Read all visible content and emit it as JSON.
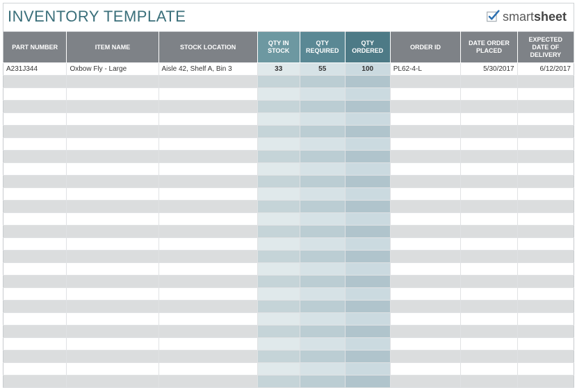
{
  "title": "INVENTORY TEMPLATE",
  "logo": {
    "brand_part1": "smart",
    "brand_part2": "sheet"
  },
  "columns": [
    "PART NUMBER",
    "ITEM NAME",
    "STOCK LOCATION",
    "QTY IN STOCK",
    "QTY REQUIRED",
    "QTY ORDERED",
    "ORDER ID",
    "DATE ORDER PLACED",
    "EXPECTED DATE OF DELIVERY"
  ],
  "rows": [
    {
      "part_number": "A231J344",
      "item_name": "Oxbow Fly - Large",
      "stock_location": "Aisle 42, Shelf A, Bin 3",
      "qty_in_stock": "33",
      "qty_required": "55",
      "qty_ordered": "100",
      "order_id": "PL62-4-L",
      "date_order_placed": "5/30/2017",
      "expected_delivery": "6/12/2017"
    }
  ],
  "empty_row_count": 25
}
